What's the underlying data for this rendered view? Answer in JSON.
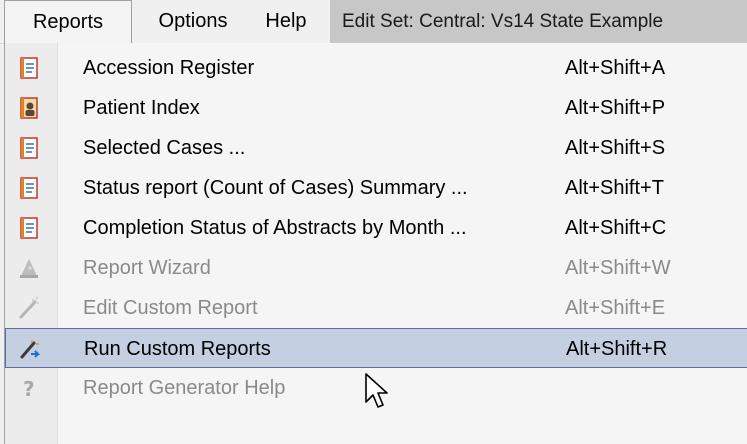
{
  "menubar": {
    "reports": "Reports",
    "options": "Options",
    "help": "Help",
    "title": "Edit Set: Central: Vs14 State Example"
  },
  "menu": {
    "items": [
      {
        "label": "Accession Register",
        "shortcut": "Alt+Shift+A",
        "icon": "report-doc-icon",
        "enabled": true
      },
      {
        "label": "Patient Index",
        "shortcut": "Alt+Shift+P",
        "icon": "patient-card-icon",
        "enabled": true
      },
      {
        "label": "Selected Cases ...",
        "shortcut": "Alt+Shift+S",
        "icon": "report-doc-icon",
        "enabled": true
      },
      {
        "label": "Status report (Count of Cases) Summary ...",
        "shortcut": "Alt+Shift+T",
        "icon": "report-doc-icon",
        "enabled": true
      },
      {
        "label": "Completion Status of Abstracts by Month ...",
        "shortcut": "Alt+Shift+C",
        "icon": "report-doc-icon",
        "enabled": true
      },
      {
        "label": "Report Wizard",
        "shortcut": "Alt+Shift+W",
        "icon": "wizard-hat-icon",
        "enabled": false
      },
      {
        "label": "Edit Custom Report",
        "shortcut": "Alt+Shift+E",
        "icon": "magic-wand-icon",
        "enabled": false
      },
      {
        "label": "Run Custom Reports",
        "shortcut": "Alt+Shift+R",
        "icon": "wand-run-icon",
        "enabled": true,
        "selected": true
      },
      {
        "label": "Report Generator Help",
        "shortcut": "",
        "icon": "help-question-icon",
        "enabled": false
      }
    ]
  },
  "colors": {
    "selected_bg": "#c5cfe2",
    "selected_border": "#5c6f99",
    "disabled_text": "#8a8a8a"
  }
}
